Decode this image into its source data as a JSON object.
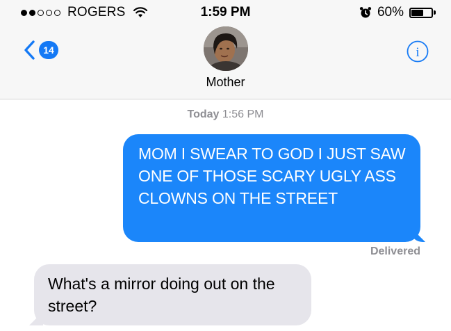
{
  "status_bar": {
    "carrier": "ROGERS",
    "time": "1:59 PM",
    "battery_percent": "60%",
    "battery_level": 0.6,
    "signal_bars_filled": 2,
    "signal_bars_total": 5,
    "icons": [
      "wifi-icon",
      "alarm-icon",
      "battery-icon"
    ]
  },
  "nav": {
    "back_badge": "14",
    "contact_name": "Mother",
    "accent_color": "#1479f5",
    "icons": [
      "chevron-left-icon",
      "info-icon"
    ]
  },
  "conversation": {
    "timestamp_day": "Today",
    "timestamp_time": "1:56 PM",
    "messages": [
      {
        "direction": "sent",
        "text": "MOM I SWEAR TO GOD I JUST SAW ONE OF THOSE SCARY UGLY ASS CLOWNS ON THE STREET",
        "color": "#1b86fa"
      },
      {
        "direction": "received",
        "text": "What's a mirror doing out on the street?",
        "color": "#e6e5eb"
      }
    ],
    "delivery_status": "Delivered"
  }
}
